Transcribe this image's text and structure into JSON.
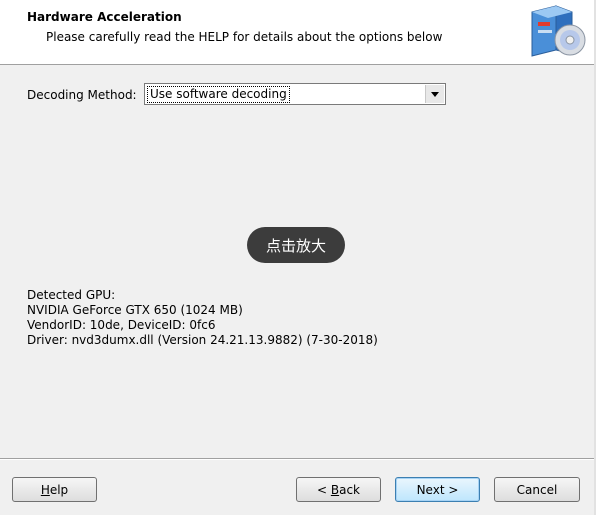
{
  "header": {
    "title": "Hardware Acceleration",
    "subtitle": "Please carefully read the HELP for details about the options below",
    "logo_icon": "software-box-cd-icon"
  },
  "decoding": {
    "label": "Decoding Method:",
    "selected_value": "Use software decoding"
  },
  "overlay": {
    "zoom_label": "点击放大"
  },
  "gpu": {
    "heading": "Detected GPU:",
    "name": "NVIDIA GeForce GTX 650 (1024 MB)",
    "ids": "VendorID: 10de, DeviceID: 0fc6",
    "driver": "Driver: nvd3dumx.dll (Version 24.21.13.9882) (7-30-2018)"
  },
  "buttons": {
    "help": {
      "prefix": "",
      "accel": "H",
      "rest": "elp"
    },
    "back": {
      "prefix": "< ",
      "accel": "B",
      "rest": "ack"
    },
    "next": "Next >",
    "cancel": "Cancel"
  }
}
